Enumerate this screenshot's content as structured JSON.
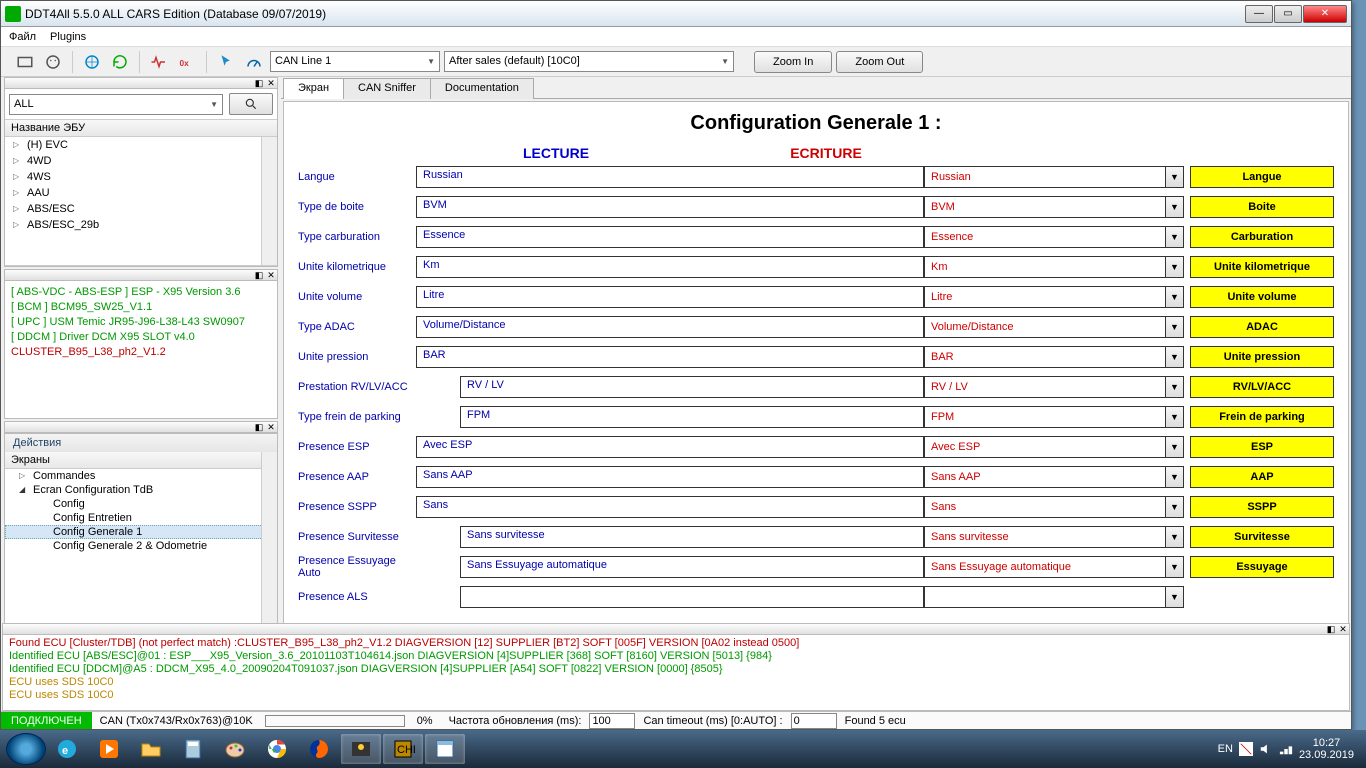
{
  "window": {
    "title": "DDT4All 5.5.0 ALL CARS Edition (Database 09/07/2019)"
  },
  "menu": {
    "file": "Файл",
    "plugins": "Plugins"
  },
  "toolbar": {
    "can_line": "CAN Line 1",
    "session": "After sales (default) [10C0]",
    "zoom_in": "Zoom In",
    "zoom_out": "Zoom Out"
  },
  "left": {
    "filter_all": "ALL",
    "ecu_name": "Название ЭБУ",
    "ecu_tree": [
      "(H) EVC",
      "4WD",
      "4WS",
      "AAU",
      "ABS/ESC",
      "ABS/ESC_29b"
    ],
    "sessions": [
      {
        "txt": "[ ABS-VDC - ABS-ESP ] ESP - X95 Version 3.6",
        "cls": "sess-g"
      },
      {
        "txt": "[ BCM ] BCM95_SW25_V1.1",
        "cls": "sess-g"
      },
      {
        "txt": "[ UPC ] USM Temic JR95-J96-L38-L43 SW0907",
        "cls": "sess-g"
      },
      {
        "txt": "[ DDCM ] Driver DCM X95 SLOT v4.0",
        "cls": "sess-g"
      },
      {
        "txt": "CLUSTER_B95_L38_ph2_V1.2",
        "cls": "sess-r"
      }
    ],
    "actions": "Действия",
    "screens": "Экраны",
    "tree": {
      "commandes": "Commandes",
      "ecran": "Ecran Configuration TdB",
      "subs": [
        "Config",
        "Config Entretien",
        "Config Generale 1",
        "Config Generale 2 & Odometrie"
      ],
      "selected": 2
    }
  },
  "tabs": {
    "t1": "Экран",
    "t2": "CAN Sniffer",
    "t3": "Documentation"
  },
  "config": {
    "title": "Configuration Generale 1 :",
    "lecture": "LECTURE",
    "ecriture": "ECRITURE",
    "rows": [
      {
        "label": "Langue",
        "read": "Russian",
        "write": "Russian",
        "btn": "Langue",
        "indent": false
      },
      {
        "label": "Type de boite",
        "read": "BVM",
        "write": "BVM",
        "btn": "Boite",
        "indent": false
      },
      {
        "label": "Type carburation",
        "read": "Essence",
        "write": "Essence",
        "btn": "Carburation",
        "indent": false
      },
      {
        "label": "Unite kilometrique",
        "read": "Km",
        "write": "Km",
        "btn": "Unite kilometrique",
        "indent": false
      },
      {
        "label": "Unite volume",
        "read": "Litre",
        "write": "Litre",
        "btn": "Unite volume",
        "indent": false
      },
      {
        "label": "Type ADAC",
        "read": "Volume/Distance",
        "write": "Volume/Distance",
        "btn": "ADAC",
        "indent": false
      },
      {
        "label": "Unite pression",
        "read": "BAR",
        "write": "BAR",
        "btn": "Unite pression",
        "indent": false
      },
      {
        "label": "Prestation RV/LV/ACC",
        "read": "RV / LV",
        "write": "RV / LV",
        "btn": "RV/LV/ACC",
        "indent": true
      },
      {
        "label": "Type frein de parking",
        "read": "FPM",
        "write": "FPM",
        "btn": "Frein de parking",
        "indent": true
      },
      {
        "label": "Presence ESP",
        "read": "Avec ESP",
        "write": "Avec ESP",
        "btn": "ESP",
        "indent": false
      },
      {
        "label": "Presence AAP",
        "read": "Sans AAP",
        "write": "Sans AAP",
        "btn": "AAP",
        "indent": false
      },
      {
        "label": "Presence SSPP",
        "read": "Sans",
        "write": "Sans",
        "btn": "SSPP",
        "indent": false
      },
      {
        "label": "Presence Survitesse",
        "read": "Sans  survitesse",
        "write": "Sans  survitesse",
        "btn": "Survitesse",
        "indent": true
      },
      {
        "label": "Presence Essuyage Auto",
        "read": "Sans Essuyage automatique",
        "write": "Sans Essuyage automatique",
        "btn": "Essuyage",
        "indent": true
      },
      {
        "label": "Presence ALS",
        "read": "",
        "write": "",
        "btn": "",
        "indent": true
      }
    ]
  },
  "log": [
    {
      "cls": "lg-r",
      "txt": "Found ECU [Cluster/TDB] (not perfect match) :CLUSTER_B95_L38_ph2_V1.2 DIAGVERSION [12] SUPPLIER [BT2] SOFT [005F] VERSION [0A02 instead 0500]"
    },
    {
      "cls": "lg-g",
      "txt": "Identified ECU [ABS/ESC]@01 : ESP___X95_Version_3.6_20101103T104614.json DIAGVERSION [4]SUPPLIER [368] SOFT [8160] VERSION [5013] {984}"
    },
    {
      "cls": "lg-g",
      "txt": "Identified ECU [DDCM]@A5 : DDCM_X95_4.0_20090204T091037.json DIAGVERSION [4]SUPPLIER [A54] SOFT [0822] VERSION [0000] {8505}"
    },
    {
      "cls": "lg-o",
      "txt": "ECU uses SDS 10C0"
    },
    {
      "cls": "lg-o",
      "txt": "ECU uses SDS 10C0"
    }
  ],
  "status": {
    "connected": "ПОДКЛЮЧЕН",
    "can": "CAN (Tx0x743/Rx0x763)@10K",
    "pct": "0%",
    "refresh_lbl": "Частота обновления (ms):",
    "refresh": "100",
    "timeout_lbl": "Can timeout (ms) [0:AUTO] :",
    "timeout": "0",
    "found": "Found 5 ecu"
  },
  "tray": {
    "lang": "EN",
    "time": "10:27",
    "date": "23.09.2019"
  }
}
